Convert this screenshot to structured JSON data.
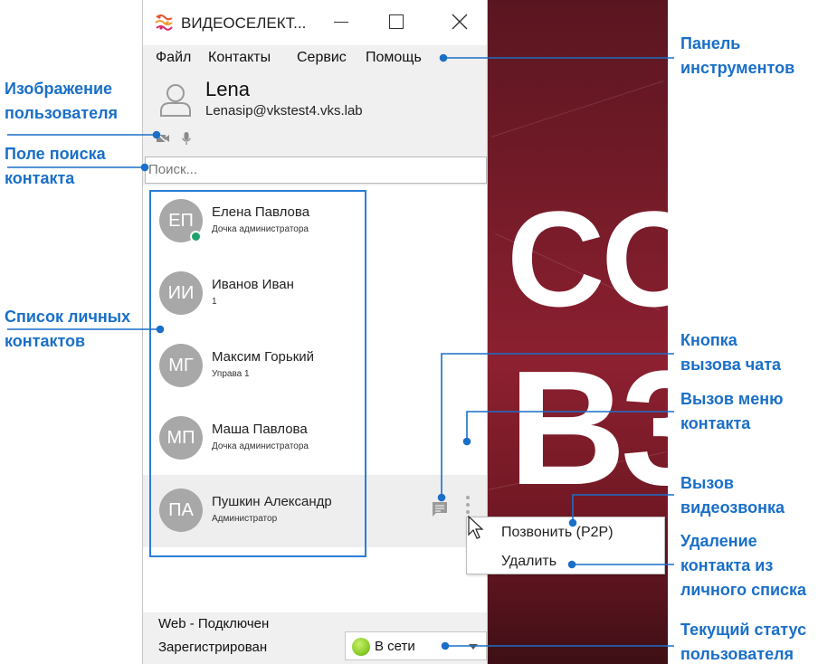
{
  "window": {
    "title": "ВИДЕОСЕЛЕКТ...",
    "close_glyph": "✕"
  },
  "menu": {
    "items": [
      {
        "label": "Файл"
      },
      {
        "label": "Контакты"
      },
      {
        "label": "Сервис"
      },
      {
        "label": "Помощь"
      }
    ]
  },
  "user": {
    "name": "Lena",
    "sip": "Lenasip@vkstest4.vks.lab"
  },
  "search": {
    "placeholder": "Поиск..."
  },
  "contacts": [
    {
      "initials": "ЕП",
      "name": "Елена Павлова",
      "subtitle": "Дочка администратора",
      "online": true,
      "selected": false
    },
    {
      "initials": "ИИ",
      "name": "Иванов Иван",
      "subtitle": "1",
      "online": false,
      "selected": false
    },
    {
      "initials": "МГ",
      "name": "Максим Горький",
      "subtitle": "Управа 1",
      "online": false,
      "selected": false
    },
    {
      "initials": "МП",
      "name": "Маша Павлова",
      "subtitle": "Дочка администратора",
      "online": false,
      "selected": false
    },
    {
      "initials": "ПА",
      "name": "Пушкин Александр",
      "subtitle": "Администратор",
      "online": false,
      "selected": true
    }
  ],
  "context_menu": {
    "call": "Позвонить (P2P)",
    "delete": "Удалить"
  },
  "statusbar": {
    "web": "Web - Подключен",
    "registration": "Зарегистрирован",
    "status": "В сети"
  },
  "background": {
    "line1": "CO",
    "line2": "B3"
  },
  "annotations": {
    "toolbar": [
      "Панель",
      "инструментов"
    ],
    "avatar": [
      "Изображение",
      "пользователя"
    ],
    "search": [
      "Поле поиска",
      "контакта"
    ],
    "contact_list": [
      "Список личных",
      "контактов"
    ],
    "chat_button": [
      "Кнопка",
      "вызова чата"
    ],
    "contact_menu": [
      "Вызов меню",
      "контакта"
    ],
    "video_call": [
      "Вызов",
      "видеозвонка"
    ],
    "delete_contact": [
      "Удаление",
      "контакта из",
      "личного списка"
    ],
    "current_status": [
      "Текущий статус",
      "пользователя"
    ]
  },
  "colors": {
    "annotation": "#1a6fc8",
    "online": "#1ca36b",
    "avatar": "#a8a8a8",
    "status_green": "#8ccc2a"
  }
}
